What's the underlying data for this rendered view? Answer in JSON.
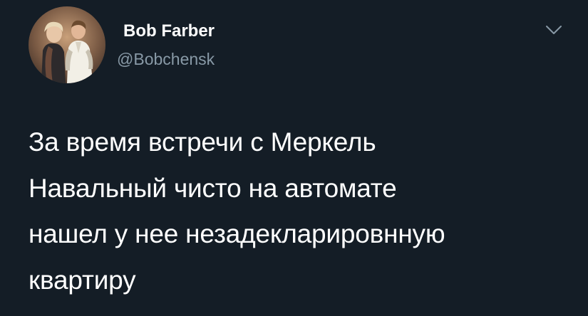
{
  "author": {
    "display_name": "Bob Farber",
    "handle": "@Bobchensk",
    "avatar_icon": "avatar-photo"
  },
  "menu": {
    "icon": "chevron-down-icon"
  },
  "tweet": {
    "lines": [
      "За время встречи с Меркель",
      "Навальный чисто на автомате",
      "нашел у нее незадекларировнную",
      "квартиру"
    ]
  },
  "colors": {
    "background": "#141d26",
    "text": "#ffffff",
    "secondary_text": "#8899a6"
  }
}
